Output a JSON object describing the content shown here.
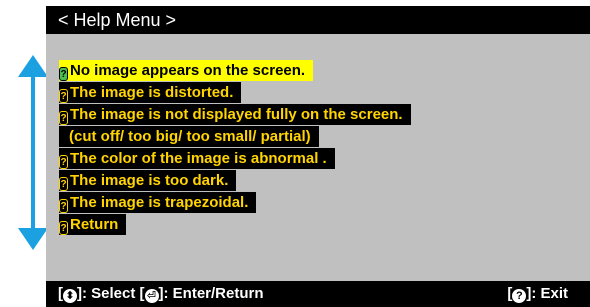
{
  "colors": {
    "panel_bg": "#c0c0c0",
    "bar_bg": "#000000",
    "item_text": "#ffd400",
    "selected_bg": "#ffff00",
    "arrow": "#1ba1e2"
  },
  "header": {
    "title": "< Help Menu >"
  },
  "menu": {
    "items": [
      {
        "label": "No image appears on the screen.",
        "icon": "question-icon",
        "selected": true
      },
      {
        "label": "The image is distorted.",
        "icon": "question-icon"
      },
      {
        "label": "The image is not displayed fully on the screen.",
        "icon": "question-icon"
      },
      {
        "label": "(cut off/ too big/ too small/ partial)",
        "icon": ""
      },
      {
        "label": "The color of the image is abnormal .",
        "icon": "question-icon"
      },
      {
        "label": "The image is too dark.",
        "icon": "question-icon"
      },
      {
        "label": "The image is trapezoidal.",
        "icon": "question-icon"
      },
      {
        "label": "Return",
        "icon": "question-icon"
      }
    ]
  },
  "footer": {
    "select_open": "[",
    "select_icon": "⬍",
    "select_label": "]: Select [",
    "enter_icon": "⏎",
    "enter_label": "]: Enter/Return",
    "exit_open": "[",
    "exit_icon": "?",
    "exit_label": "]: Exit"
  }
}
